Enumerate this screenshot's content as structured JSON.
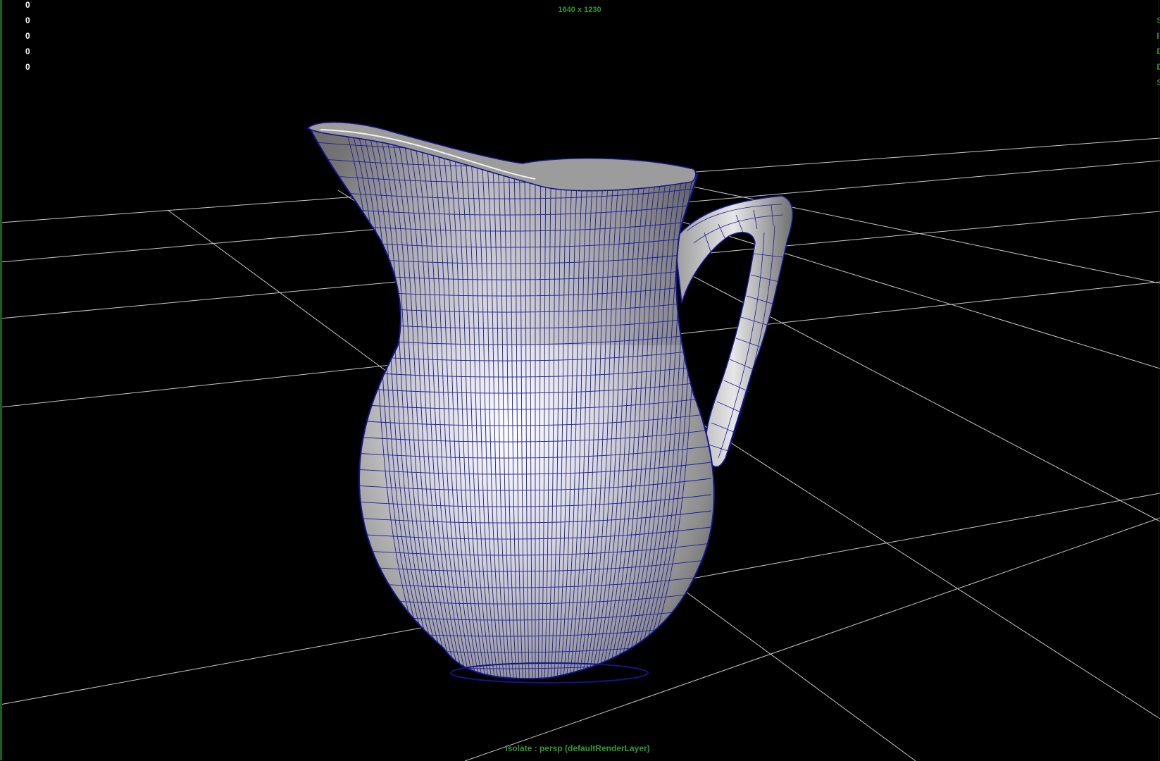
{
  "viewport": {
    "resolution_label": "1640 x 1230",
    "isolate_label": "Isolate : persp (defaultRenderLayer)",
    "hud_counts": [
      "0",
      "0",
      "0",
      "0",
      "0"
    ],
    "hud_right_letters": [
      "S",
      "I",
      "D",
      "D",
      "S"
    ],
    "colors": {
      "background": "#000000",
      "grid": "#c8c8c8",
      "wireframe": "#1a1aa0",
      "hud_text": "#2e9c2e",
      "count_text": "#ffffff"
    },
    "object_icon": "pitcher-mesh"
  }
}
